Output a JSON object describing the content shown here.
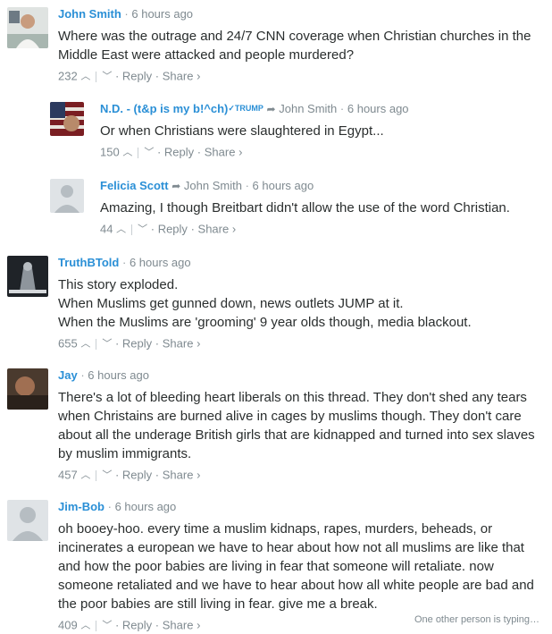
{
  "comments": [
    {
      "author": "John Smith",
      "time": "6 hours ago",
      "lines": [
        "Where was the outrage and 24/7 CNN coverage when Christian churches in the Middle East were attacked and people murdered?"
      ],
      "upvotes": "232"
    },
    {
      "author": "N.D. - (t&p is my b!^ch)",
      "badge": "✓TRUMP",
      "reply_to": "John Smith",
      "time": "6 hours ago",
      "lines": [
        "Or when Christians were slaughtered in Egypt..."
      ],
      "upvotes": "150"
    },
    {
      "author": "Felicia Scott",
      "reply_to": "John Smith",
      "time": "6 hours ago",
      "lines": [
        "Amazing, I though Breitbart didn't allow the use of the word Christian."
      ],
      "upvotes": "44"
    },
    {
      "author": "TruthBTold",
      "time": "6 hours ago",
      "lines": [
        "This story exploded.",
        "When Muslims get gunned down, news outlets JUMP at it.",
        "When the Muslims are 'grooming' 9 year olds though, media blackout."
      ],
      "upvotes": "655"
    },
    {
      "author": "Jay",
      "time": "6 hours ago",
      "lines": [
        "There's a lot of bleeding heart liberals on this thread. They don't shed any tears when Christains are burned alive in cages by muslims though. They don't care about all the underage British girls that are kidnapped and turned into sex slaves by muslim immigrants."
      ],
      "upvotes": "457"
    },
    {
      "author": "Jim-Bob",
      "time": "6 hours ago",
      "lines": [
        "oh booey-hoo. every time a muslim kidnaps, rapes, murders, beheads, or incinerates a european we have to hear about how not all muslims are like that and how the poor babies are living in fear that someone will retaliate. now someone retaliated and we have to hear about how all white people are bad and the poor babies are still living in fear. give me a break."
      ],
      "upvotes": "409"
    }
  ],
  "actions": {
    "reply": "Reply",
    "share": "Share ›",
    "sep": "·"
  },
  "typing_indicator": "One other person is typing…",
  "colors": {
    "author": "#2a8fd6",
    "meta": "#7f8a90",
    "text": "#2a2e2e"
  },
  "icons": {
    "upvote": "chevron-up-icon",
    "downvote": "chevron-down-icon",
    "reply_to": "reply-arrow-icon"
  }
}
